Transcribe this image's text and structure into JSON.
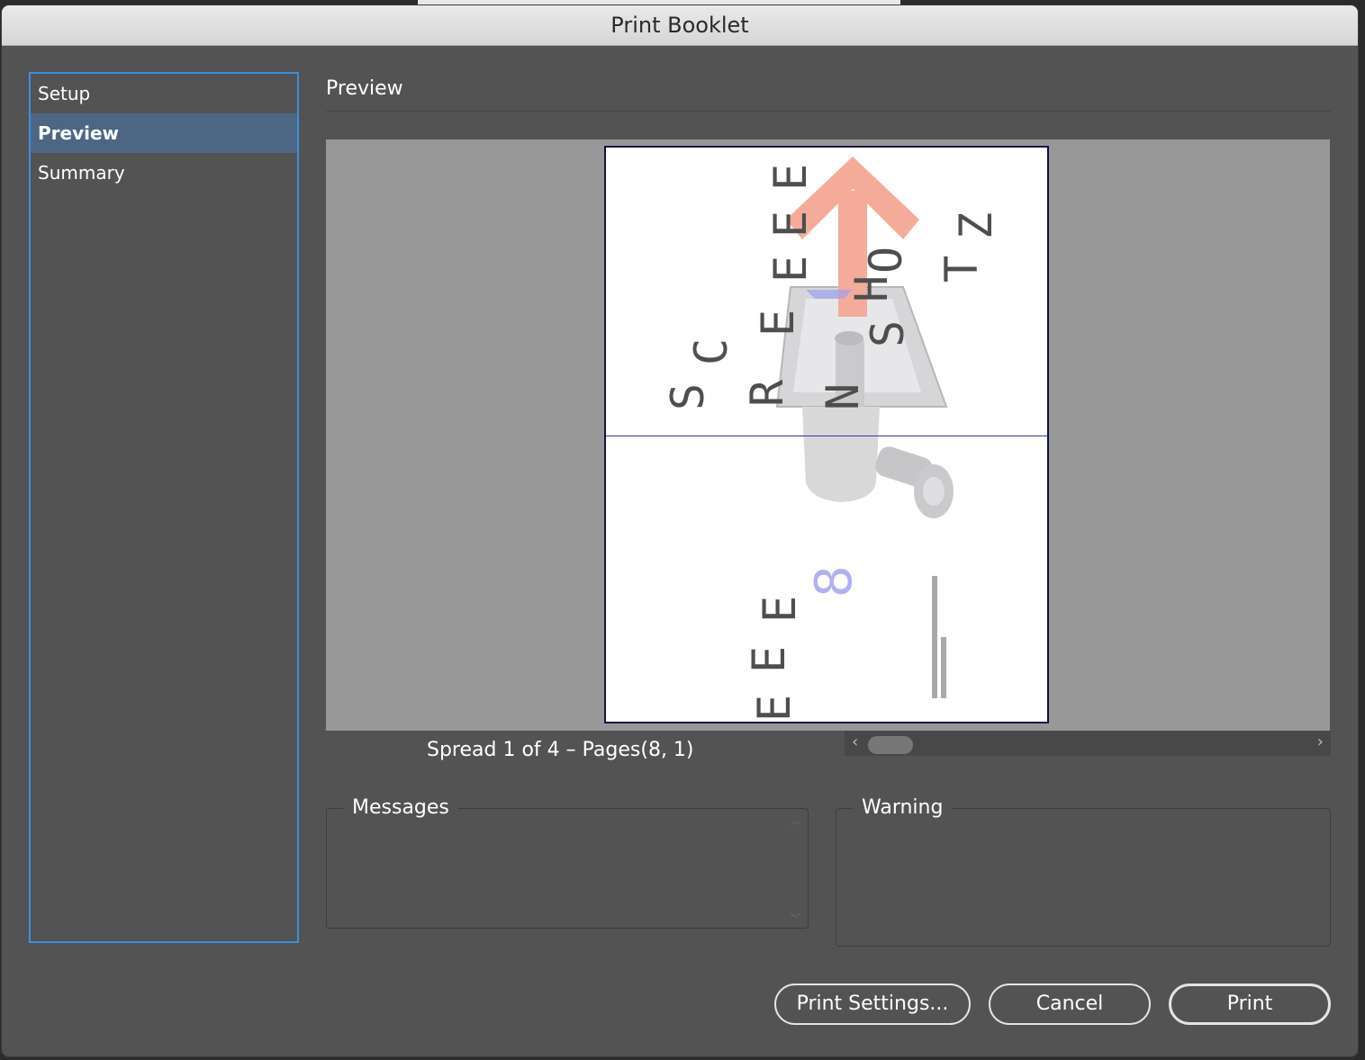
{
  "window": {
    "title": "Print Booklet"
  },
  "sidebar": {
    "items": [
      {
        "label": "Setup"
      },
      {
        "label": "Preview"
      },
      {
        "label": "Summary"
      }
    ]
  },
  "section": {
    "title": "Preview"
  },
  "preview": {
    "spread_label": "Spread 1 of 4 – Pages(8, 1)",
    "sheet_letters": [
      "S",
      "C",
      "R",
      "E",
      "E",
      "N",
      "S",
      "H",
      "O",
      "T",
      "Z",
      "E",
      "E",
      "E",
      "E",
      "E",
      "8"
    ]
  },
  "messages": {
    "title": "Messages"
  },
  "warning": {
    "title": "Warning"
  },
  "buttons": {
    "print_settings": "Print Settings...",
    "cancel": "Cancel",
    "print": "Print"
  },
  "icons": {
    "scroll_left": "chevron-left-icon",
    "scroll_right": "chevron-right-icon"
  },
  "colors": {
    "panel": "#535353",
    "sidebar_border": "#3d8ee0",
    "selected_item": "#4d6684",
    "arrow": "#f4ab9a",
    "accent_blue": "#b0b0f4"
  }
}
